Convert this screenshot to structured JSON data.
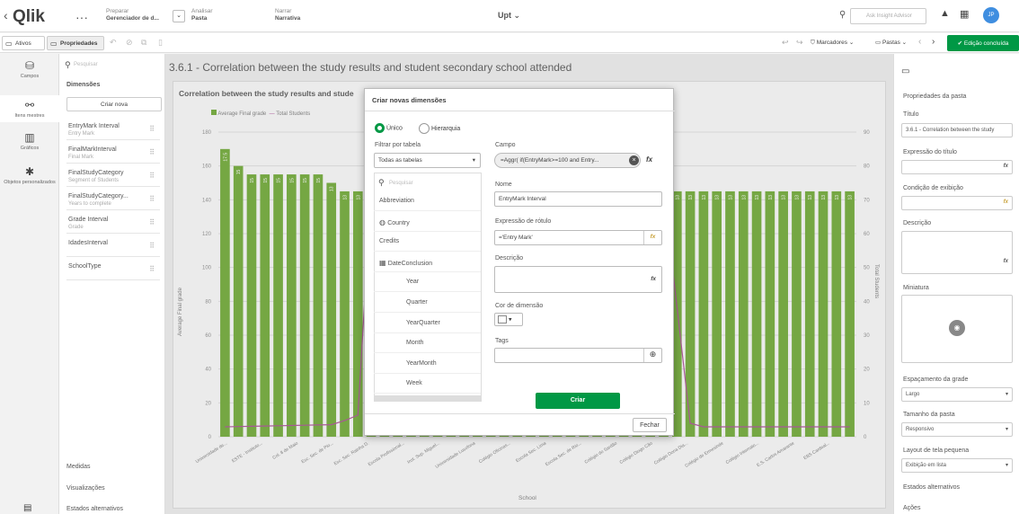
{
  "header": {
    "logo": "Qlik",
    "menu_dots": "···",
    "prepare_label": "Preparar",
    "prepare_value": "Gerenciador de d...",
    "analyze_label": "Analisar",
    "analyze_value": "Pasta",
    "narrate_label": "Narrar",
    "narrate_value": "Narrativa",
    "app_title": "Upt ⌄",
    "insight_placeholder": "Ask Insight Advisor",
    "avatar_text": "JP"
  },
  "toolbar": {
    "assets": "Ativos",
    "properties": "Propriedades",
    "bookmarks": "Marcadores",
    "sheets": "Pastas",
    "done_editing": "Edição concluída"
  },
  "rail": {
    "fields": "Campos",
    "master_items": "Itens mestres",
    "charts": "Gráficos",
    "custom_objects": "Objetos personalizados"
  },
  "left_panel": {
    "search_placeholder": "Pesquisar",
    "dimensions": "Dimensões",
    "create_new": "Criar nova",
    "fields": [
      {
        "name": "EntryMark Interval",
        "sub": "Entry Mark"
      },
      {
        "name": "FinalMarkInterval",
        "sub": "Final Mark"
      },
      {
        "name": "FinalStudyCategory",
        "sub": "Segment of Students"
      },
      {
        "name": "FinalStudyCategory...",
        "sub": "Years to complete"
      },
      {
        "name": "Grade Interval",
        "sub": "Grade"
      },
      {
        "name": "IdadesInterval",
        "sub": ""
      },
      {
        "name": "SchoolType",
        "sub": ""
      }
    ],
    "measures": "Medidas",
    "visualizations": "Visualizações",
    "alt_states": "Estados alternativos"
  },
  "sheet": {
    "title": "3.6.1 - Correlation between the study results and student secondary school attended",
    "chart_title": "Correlation between the study results and stude",
    "legend_avg": "Average Final grade",
    "legend_total": "Total Students",
    "y_label": "Average Final grade",
    "y2_label": "Total Students",
    "x_label": "School",
    "colors": {
      "bar": "#7db248",
      "line": "#b35fa0"
    }
  },
  "chart_data": {
    "type": "bar",
    "y_ticks": [
      "180",
      "160",
      "140",
      "120",
      "100",
      "80",
      "60",
      "40",
      "20",
      "0"
    ],
    "y2_ticks": [
      "90",
      "80",
      "70",
      "60",
      "50",
      "40",
      "30",
      "20",
      "10",
      "0"
    ],
    "bar_labels": [
      "17.5",
      "15",
      "15",
      "15",
      "15",
      "15",
      "15",
      "15",
      "13",
      "13",
      "13",
      "13",
      "13",
      "13",
      "13",
      "13",
      "13",
      "13",
      "13",
      "13",
      "13",
      "13",
      "13",
      "13",
      "13",
      "13",
      "13",
      "13",
      "13",
      "13",
      "13",
      "13",
      "13",
      "13",
      "13",
      "13",
      "13",
      "13",
      "13",
      "13",
      "13",
      "13",
      "13",
      "13",
      "13",
      "13",
      "13",
      "13"
    ],
    "values": [
      170,
      160,
      155,
      155,
      155,
      155,
      155,
      155,
      150,
      145,
      145,
      145,
      145,
      145,
      145,
      145,
      145,
      145,
      145,
      145,
      145,
      145,
      145,
      145,
      145,
      145,
      145,
      145,
      145,
      145,
      145,
      145,
      145,
      145,
      145,
      145,
      145,
      145,
      145,
      145,
      145,
      145,
      145,
      145,
      145,
      145,
      145,
      145
    ],
    "categories_visible": [
      "Universidade de...",
      "ESTE - Instituto...",
      "Col. 8 de Maio",
      "Esc. Sec. de Pio...",
      "Esc. Sec. Rainha D.",
      "Escola Profissional...",
      "Inst. Sup. Miguel...",
      "Universidade Lusofona",
      "Colégio Oficinas...",
      "Escola Sec. Lima",
      "Escola Sec. de Rio...",
      "Colégio do Sardão",
      "Colégio Diogo Cão",
      "Colégio Dona Dia...",
      "Colégio de Ermesinde",
      "Colégio Internato...",
      "E.S. Carlos Amarante",
      "EBS Cardeal..."
    ]
  },
  "dialog": {
    "title": "Criar novas dimensões",
    "single": "Único",
    "hierarchy": "Hierarquia",
    "filter_by_table": "Filtrar por tabela",
    "all_tables": "Todas as tabelas",
    "search_placeholder": "Pesquisar",
    "field_list": [
      {
        "label": "Abbreviation",
        "indent": false,
        "icon": ""
      },
      {
        "label": "Country",
        "indent": false,
        "icon": "globe"
      },
      {
        "label": "Credits",
        "indent": false,
        "icon": ""
      },
      {
        "label": "DateConclusion",
        "indent": false,
        "icon": "calendar"
      },
      {
        "label": "Year",
        "indent": true,
        "icon": ""
      },
      {
        "label": "Quarter",
        "indent": true,
        "icon": ""
      },
      {
        "label": "YearQuarter",
        "indent": true,
        "icon": ""
      },
      {
        "label": "Month",
        "indent": true,
        "icon": ""
      },
      {
        "label": "YearMonth",
        "indent": true,
        "icon": ""
      },
      {
        "label": "Week",
        "indent": true,
        "icon": ""
      }
    ],
    "field_label": "Campo",
    "field_value": "=Aggr( if(EntryMark>=100 and Entry...",
    "name_label": "Nome",
    "name_value": "EntryMark Interval",
    "label_expr_label": "Expressão de rótulo",
    "label_expr_value": "='Entry Mark'",
    "description_label": "Descrição",
    "dim_color_label": "Cor de dimensão",
    "tags_label": "Tags",
    "create_button": "Criar",
    "close_button": "Fechar"
  },
  "right_panel": {
    "sheet_properties": "Propriedades da pasta",
    "title_label": "Título",
    "title_value": "3.6.1 - Correlation between the study",
    "title_expr_label": "Expressão do título",
    "show_condition_label": "Condição de exibição",
    "description_label": "Descrição",
    "thumbnail_label": "Miniatura",
    "grid_spacing_label": "Espaçamento da grade",
    "grid_spacing_value": "Largo",
    "sheet_size_label": "Tamanho da pasta",
    "sheet_size_value": "Responsivo",
    "small_layout_label": "Layout de tela pequena",
    "small_layout_value": "Exibição em lista",
    "alt_states": "Estados alternativos",
    "actions": "Ações"
  }
}
